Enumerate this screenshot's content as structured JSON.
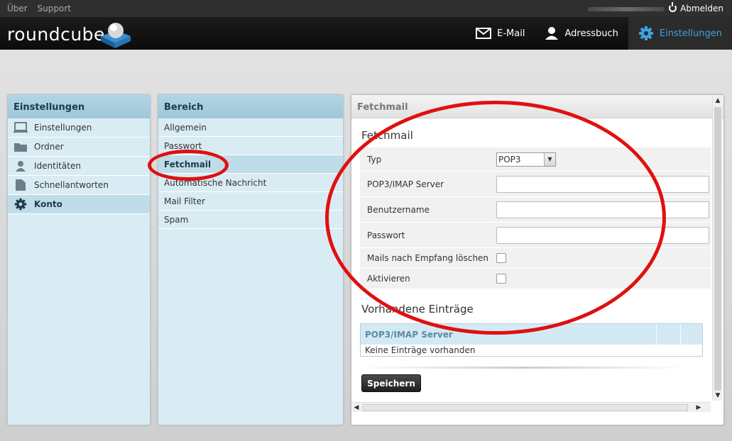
{
  "topbar": {
    "about": "Über",
    "support": "Support",
    "logout": "Abmelden"
  },
  "brand": "roundcube",
  "nav": {
    "mail": "E-Mail",
    "addressbook": "Adressbuch",
    "settings": "Einstellungen"
  },
  "settings_panel": {
    "title": "Einstellungen",
    "items": [
      "Einstellungen",
      "Ordner",
      "Identitäten",
      "Schnellantworten",
      "Konto"
    ],
    "selected": "Konto"
  },
  "section_panel": {
    "title": "Bereich",
    "items": [
      "Allgemein",
      "Passwort",
      "Fetchmail",
      "Automatische Nachricht",
      "Mail Filter",
      "Spam"
    ],
    "selected": "Fetchmail"
  },
  "content": {
    "header": "Fetchmail",
    "section_title": "Fetchmail",
    "fields": {
      "type_label": "Typ",
      "type_value": "POP3",
      "server_label": "POP3/IMAP Server",
      "server_value": "",
      "user_label": "Benutzername",
      "user_value": "",
      "pass_label": "Passwort",
      "pass_value": "",
      "delete_label": "Mails nach Empfang löschen",
      "enable_label": "Aktivieren"
    },
    "existing_title": "Vorhandene Einträge",
    "table": {
      "header": "POP3/IMAP Server",
      "empty": "Keine Einträge vorhanden"
    },
    "save_label": "Speichern"
  },
  "colors": {
    "accent": "#3fa3e0",
    "highlight_ring": "#e01010",
    "panel_bg": "#d9ecf4"
  }
}
